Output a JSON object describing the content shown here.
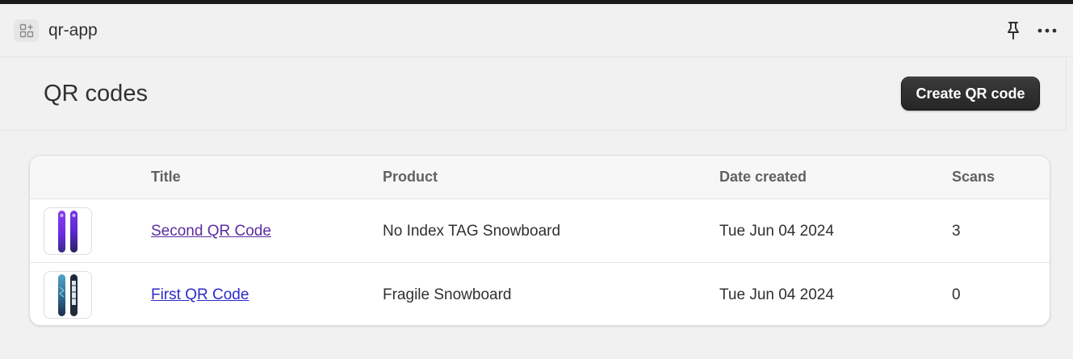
{
  "app": {
    "name": "qr-app",
    "icon": "app-grid-icon"
  },
  "toolbar": {
    "pin_icon": "pin-icon",
    "more_icon": "more-horizontal-icon"
  },
  "page": {
    "title": "QR codes",
    "primary_action": "Create QR code"
  },
  "table": {
    "columns": [
      "",
      "Title",
      "Product",
      "Date created",
      "Scans"
    ],
    "rows": [
      {
        "thumbnail": "snowboard-purple-thumbnail",
        "title": "Second QR Code",
        "product": "No Index TAG Snowboard",
        "date_created": "Tue Jun 04 2024",
        "scans": "3"
      },
      {
        "thumbnail": "snowboard-blue-thumbnail",
        "title": "First QR Code",
        "product": "Fragile Snowboard",
        "date_created": "Tue Jun 04 2024",
        "scans": "0"
      }
    ]
  },
  "colors": {
    "visited_link": "#5b2da0",
    "link": "#2c2ccc",
    "primary_button": "#303030"
  }
}
